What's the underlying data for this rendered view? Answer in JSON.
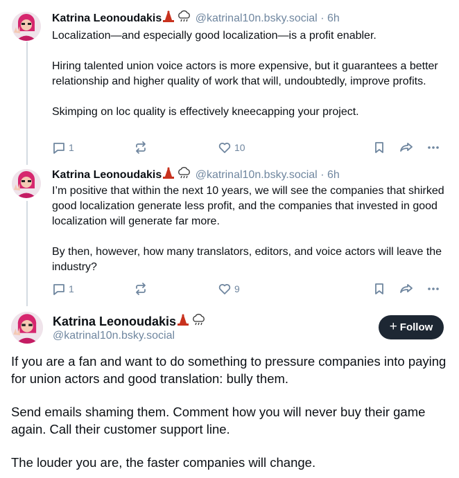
{
  "posts": [
    {
      "author": "Katrina Leonoudakis",
      "handle": "@katrinal10n.bsky.social",
      "time": "6h",
      "paragraphs": [
        "Localization—and especially good localization—is a profit enabler.",
        "Hiring talented union voice actors is more expensive, but it guarantees a better relationship and higher quality of work that will, undoubtedly, improve profits.",
        "Skimping on loc quality is effectively kneecapping your project."
      ],
      "reply_count": "1",
      "like_count": "10"
    },
    {
      "author": "Katrina Leonoudakis",
      "handle": "@katrinal10n.bsky.social",
      "time": "6h",
      "paragraphs": [
        "I’m positive that within the next 10 years, we will see the companies that shirked good localization generate less profit, and the companies that invested in good localization will generate far more.",
        "By then, however, how many translators, editors, and voice actors will leave the industry?"
      ],
      "reply_count": "1",
      "like_count": "9"
    }
  ],
  "main_post": {
    "author": "Katrina Leonoudakis",
    "handle": "@katrinal10n.bsky.social",
    "follow_label": "Follow",
    "follow_plus": "+",
    "paragraphs": [
      "If you are a fan and want to do something to pressure companies into paying for union actors and good translation: bully them.",
      "Send emails shaming them. Comment how you will never buy their game again. Call their customer support line.",
      "The louder you are, the faster companies will change."
    ]
  },
  "separator": "·",
  "icons": [
    "reply-icon",
    "repost-icon",
    "like-icon",
    "bookmark-icon",
    "share-icon",
    "more-icon",
    "bell-emoji-icon",
    "cloud-emoji-icon"
  ],
  "colors": {
    "text": "#0b0f14",
    "muted": "#6f869f",
    "follow_bg": "#1d2733",
    "thread_line": "#d4dbe2"
  }
}
